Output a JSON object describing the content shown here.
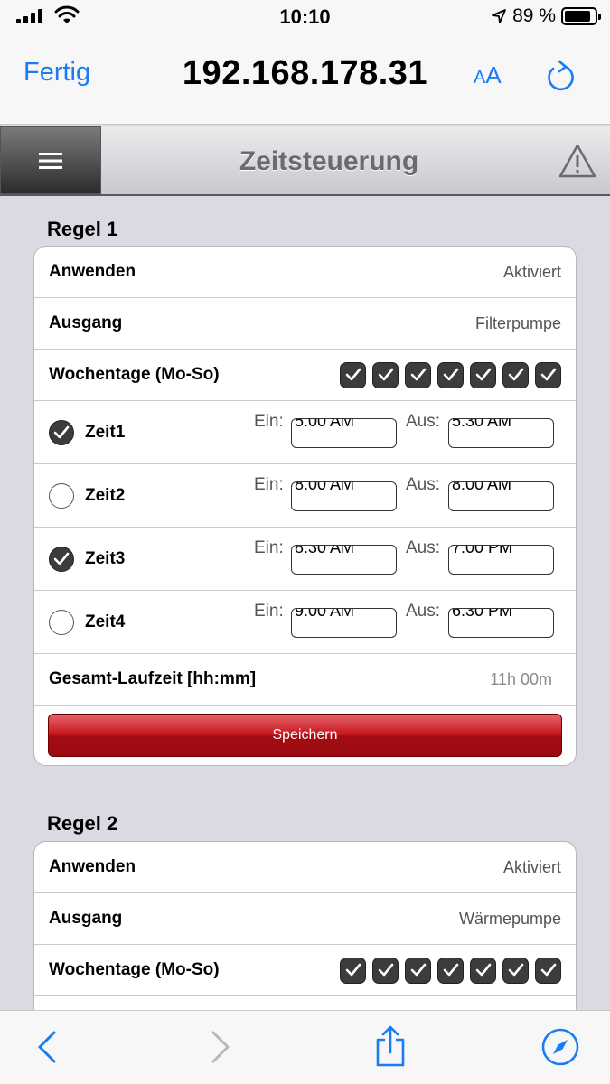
{
  "status": {
    "time": "10:10",
    "battery": "89 %",
    "battery_fraction": 0.89
  },
  "browser": {
    "done_label": "Fertig",
    "url": "192.168.178.31",
    "text_size_big": "A",
    "text_size_small": "A"
  },
  "app": {
    "title": "Zeitsteuerung",
    "menu_glyph": "≡"
  },
  "rules": [
    {
      "title": "Regel 1",
      "apply_label": "Anwenden",
      "apply_value": "Aktiviert",
      "output_label": "Ausgang",
      "output_value": "Filterpumpe",
      "weekdays_label": "Wochentage (Mo-So)",
      "weekdays": [
        true,
        true,
        true,
        true,
        true,
        true,
        true
      ],
      "times": [
        {
          "label": "Zeit1",
          "enabled": true,
          "on_label": "Ein:",
          "on": "5:00 AM",
          "off_label": "Aus:",
          "off": "5:30 AM"
        },
        {
          "label": "Zeit2",
          "enabled": false,
          "on_label": "Ein:",
          "on": "8:00 AM",
          "off_label": "Aus:",
          "off": "8:00 AM"
        },
        {
          "label": "Zeit3",
          "enabled": true,
          "on_label": "Ein:",
          "on": "8:30 AM",
          "off_label": "Aus:",
          "off": "7:00 PM"
        },
        {
          "label": "Zeit4",
          "enabled": false,
          "on_label": "Ein:",
          "on": "9:00 AM",
          "off_label": "Aus:",
          "off": "6:30 PM"
        }
      ],
      "total_label": "Gesamt-Laufzeit [hh:mm]",
      "total_value": "11h 00m",
      "save_label": "Speichern"
    },
    {
      "title": "Regel 2",
      "apply_label": "Anwenden",
      "apply_value": "Aktiviert",
      "output_label": "Ausgang",
      "output_value": "Wärmepumpe",
      "weekdays_label": "Wochentage (Mo-So)",
      "weekdays": [
        true,
        true,
        true,
        true,
        true,
        true,
        true
      ]
    }
  ],
  "icons": {
    "signal": "cellular-signal-icon",
    "wifi": "wifi-icon",
    "location": "location-arrow-icon",
    "battery": "battery-icon",
    "reload": "reload-icon",
    "menu": "hamburger-menu-icon",
    "warning": "warning-icon",
    "back": "chevron-left-icon",
    "forward": "chevron-right-icon",
    "share": "share-icon",
    "compass": "compass-icon"
  },
  "colors": {
    "accent": "#1a7cf4",
    "save": "#b3121a",
    "checkbox": "#3c3c3e"
  }
}
